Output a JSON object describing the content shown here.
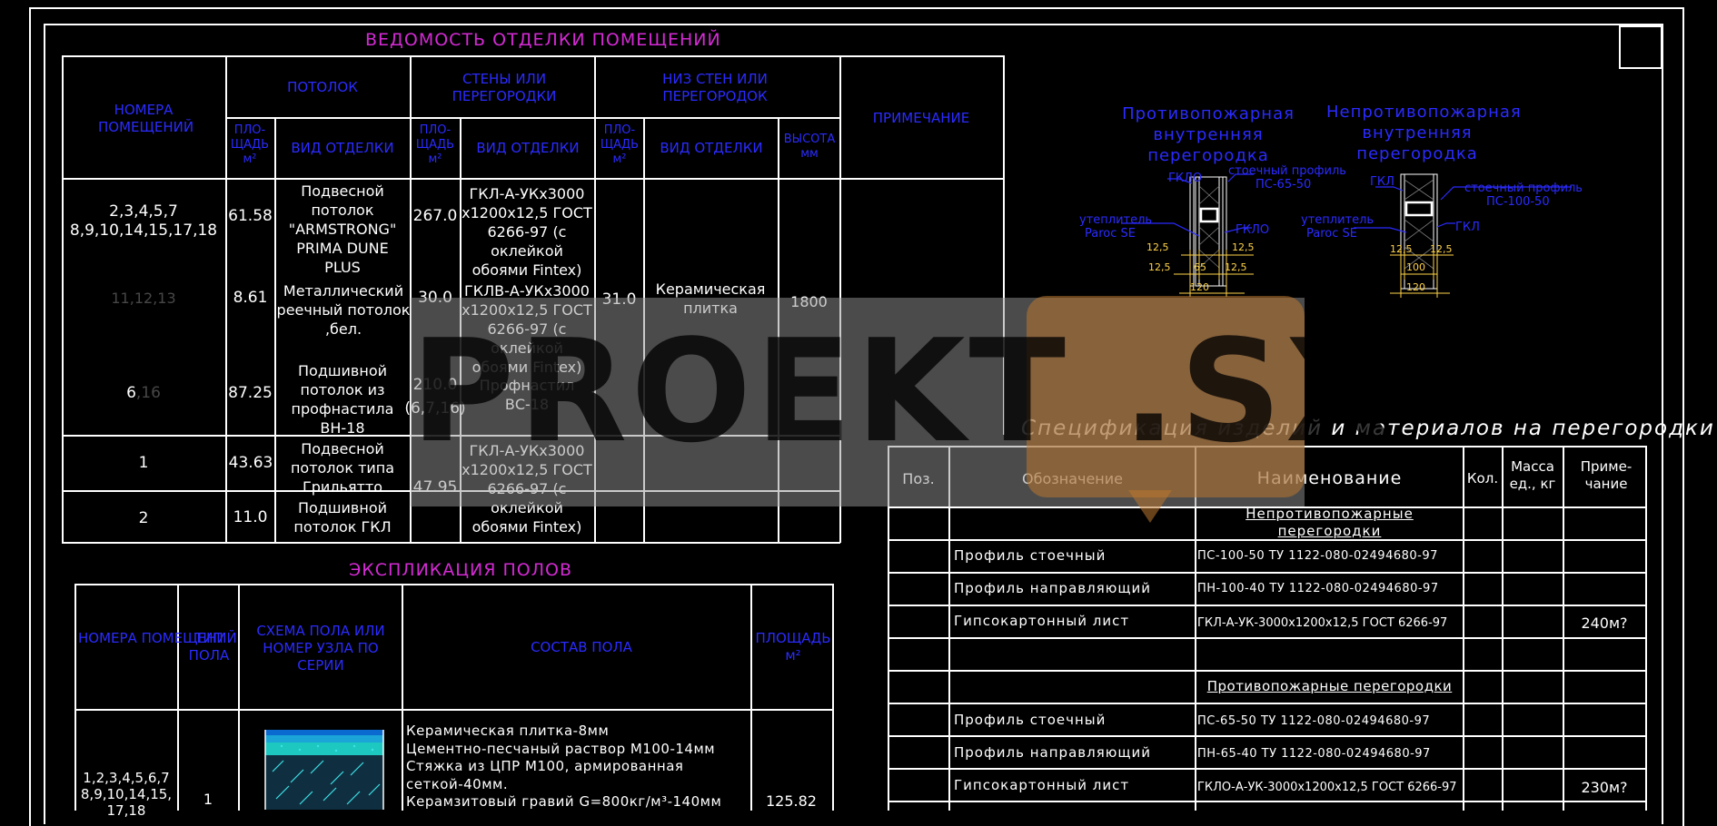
{
  "finish_schedule": {
    "title": "ВЕДОМОСТЬ ОТДЕЛКИ ПОМЕЩЕНИЙ",
    "headers": {
      "rooms": "НОМЕРА ПОМЕЩЕНИЙ",
      "ceiling": "ПОТОЛОК",
      "walls": "СТЕНЫ ИЛИ ПЕРЕГОРОДКИ",
      "lower_walls": "НИЗ СТЕН ИЛИ ПЕРЕГОРОДОК",
      "note": "ПРИМЕЧАНИЕ",
      "area": "ПЛО- ЩАДЬ м²",
      "finish_type": "ВИД ОТДЕЛКИ",
      "height": "ВЫСОТА мм"
    },
    "rows": [
      {
        "rooms": "2,3,4,5,7 8,9,10,14,15,17,18",
        "ceiling_area": "61.58",
        "ceiling_finish": "Подвесной потолок \"ARMSTRONG\" PRIMA DUNE PLUS",
        "wall_area": "267.0",
        "wall_finish": "ГКЛ-А-УКх3000 х1200х12,5 ГОСТ 6266-97 (с оклейкой обоями Fintex)"
      },
      {
        "rooms": "11,12,13",
        "ceiling_area": "8.61",
        "ceiling_finish": "Металлический реечный потолок ,бел.",
        "wall_area": "30.0",
        "wall_finish": "ГКЛВ-А-УКх3000 х1200х12,5 ГОСТ 6266-97 (с оклейкой обоями Fintex)",
        "lower_area": "31.0",
        "lower_finish": "Керамическая плитка",
        "lower_height": "1800"
      },
      {
        "rooms_main": "6",
        "rooms_dim": ",16",
        "ceiling_area": "87.25",
        "ceiling_finish": "Подшивной потолок из профнастила ВН-18",
        "wall_area": "210.0",
        "wall_area_note": "(6,7,16)",
        "wall_finish": "Профнастил ВС-18"
      },
      {
        "rooms": "1",
        "ceiling_area": "43.63",
        "ceiling_finish": "Подвесной потолок типа Грильятто",
        "wall_area": "47.95",
        "wall_finish": "ГКЛ-А-УКх3000 х1200х12,5 ГОСТ 6266-97 (с оклейкой обоями Fintex)"
      },
      {
        "rooms": "2",
        "ceiling_area": "11.0",
        "ceiling_finish": "Подшивной потолок ГКЛ"
      }
    ]
  },
  "floor_schedule": {
    "title": "ЭКСПЛИКАЦИЯ ПОЛОВ",
    "headers": {
      "rooms": "НОМЕРА ПОМЕЩЕНИЙ",
      "type": "ТИП ПОЛА",
      "scheme": "СХЕМА ПОЛА ИЛИ НОМЕР УЗЛА ПО СЕРИИ",
      "composition": "СОСТАВ ПОЛА",
      "area": "ПЛОЩАДЬ м²"
    },
    "rows": [
      {
        "rooms": "1,2,3,4,5,6,7 8,9,10,14,15, 17,18",
        "type": "1",
        "composition": [
          "Керамическая плитка-8мм",
          "Цементно-песчаный раствор М100-14мм",
          "Стяжка из ЦПР М100, армированная",
          "сеткой-40мм.",
          "Керамзитовый гравий G=800кг/м³-140мм"
        ],
        "area": "125.82"
      }
    ]
  },
  "partition_details": {
    "fire_title": "Противопожарная внутренняя перегородка",
    "nonfire_title": "Непротивопожарная внутренняя перегородка",
    "fire_labels": {
      "gklo_top": "ГКЛО",
      "stud": "стоечный профиль",
      "stud_code": "ПС-65-50",
      "insulation": "утеплитель",
      "insulation_brand": "Paroc SE",
      "gklo_right": "ГКЛО"
    },
    "fire_dims": {
      "left_a": "12,5",
      "right_a": "12,5",
      "left_b": "12,5",
      "mid": "65",
      "right_b": "12,5",
      "total": "120"
    },
    "nonfire_labels": {
      "gkl_top": "ГКЛ",
      "stud": "стоечный профиль",
      "stud_code": "ПС-100-50",
      "insulation": "утеплитель",
      "insulation_brand": "Paroc SE",
      "gkl_right": "ГКЛ"
    },
    "nonfire_dims": {
      "left": "12,5",
      "right": "12,5",
      "mid": "100",
      "total": "120"
    }
  },
  "spec": {
    "title": "Спецификация изделий и материалов на перегородки",
    "headers": {
      "pos": "Поз.",
      "designation": "Обозначение",
      "name": "Наименование",
      "qty": "Кол.",
      "mass": "Масса ед., кг",
      "note": "Приме- чание"
    },
    "rows": [
      {
        "section": "Непротивопожарные перегородки"
      },
      {
        "designation": "Профиль стоечный",
        "name": "ПС-100-50 ТУ 1122-080-02494680-97"
      },
      {
        "designation": "Профиль направляющий",
        "name": "ПН-100-40 ТУ 1122-080-02494680-97"
      },
      {
        "designation": "Гипсокартонный лист",
        "name": "ГКЛ-А-УК-3000х1200х12,5 ГОСТ 6266-97",
        "note": "240м?"
      },
      {},
      {
        "section": "Противопожарные перегородки"
      },
      {
        "designation": "Профиль стоечный",
        "name": "ПС-65-50 ТУ 1122-080-02494680-97"
      },
      {
        "designation": "Профиль направляющий",
        "name": "ПН-65-40 ТУ 1122-080-02494680-97"
      },
      {
        "designation": "Гипсокартонный лист",
        "name": "ГКЛО-А-УК-3000х1200х12,5 ГОСТ 6266-97",
        "note": "230м?"
      }
    ]
  },
  "watermark": {
    "text": "PROEKT .SX"
  },
  "colors": {
    "header_blue": "#2b2bff",
    "title_magenta": "#d42ad4",
    "dim_yellow": "#ffd34a",
    "line_white": "#ffffff",
    "watermark_orange": "#ba7630"
  }
}
